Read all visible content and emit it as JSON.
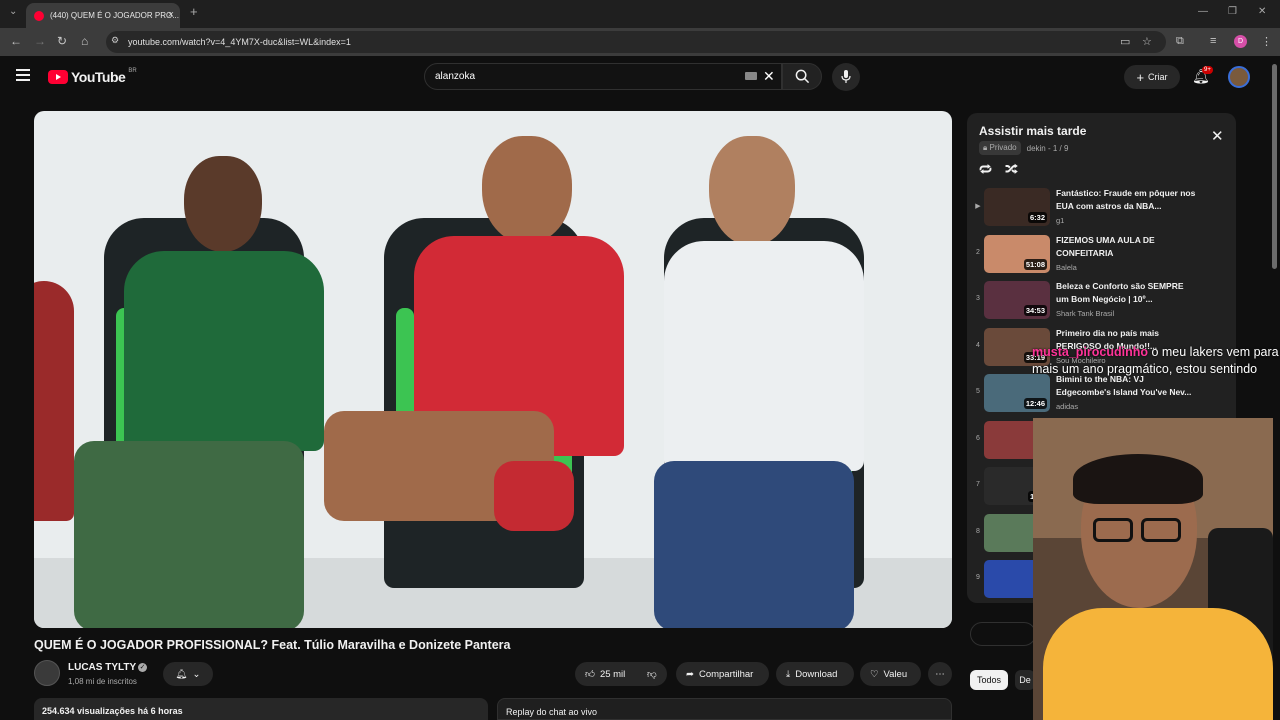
{
  "browser": {
    "tab_title": "(440) QUEM É O JOGADOR PRO...",
    "url": "youtube.com/watch?v=4_4YM7X-duc&list=WL&index=1",
    "profile_initial": "D"
  },
  "header": {
    "logo_text": "YouTube",
    "country_code": "BR",
    "search_value": "alanzoka",
    "create_label": "Criar",
    "notif_count": "9+"
  },
  "video": {
    "title": "QUEM É O JOGADOR PROFISSIONAL? Feat. Túlio Maravilha e Donizete Pantera",
    "channel_name": "LUCAS TYLTY",
    "subscribers": "1,08 mi de inscritos",
    "likes": "25 mil",
    "share_label": "Compartilhar",
    "download_label": "Download",
    "thanks_label": "Valeu",
    "views_info": "254.634 visualizações  há 6 horas",
    "chat_replay": "Replay do chat ao vivo"
  },
  "playlist": {
    "title": "Assistir mais tarde",
    "privacy": "Privado",
    "owner_progress": "dekin - 1 / 9",
    "items": [
      {
        "index": "▶",
        "title": "Fantástico: Fraude em pôquer nos EUA com astros da NBA...",
        "channel": "g1",
        "duration": "6:32",
        "thumb_color": "#3a2a24"
      },
      {
        "index": "2",
        "title": "FIZEMOS UMA AULA DE CONFEITARIA",
        "channel": "Balela",
        "duration": "51:08",
        "thumb_color": "#c98a6a"
      },
      {
        "index": "3",
        "title": "Beleza e Conforto são SEMPRE um Bom Negócio | 10º...",
        "channel": "Shark Tank Brasil",
        "duration": "34:53",
        "thumb_color": "#5a3040"
      },
      {
        "index": "4",
        "title": "Primeiro dia no país mais PERIGOSO do Mundo!!...",
        "channel": "Sou Mochileiro",
        "duration": "33:19",
        "thumb_color": "#6a4a3a"
      },
      {
        "index": "5",
        "title": "Bimini to the NBA: VJ Edgecombe's Island You've Nev...",
        "channel": "adidas",
        "duration": "12:46",
        "thumb_color": "#4a6a7a"
      },
      {
        "index": "6",
        "title": "",
        "channel": "",
        "duration": "2",
        "thumb_color": "#8a3a3a"
      },
      {
        "index": "7",
        "title": "",
        "channel": "",
        "duration": "1:00",
        "thumb_color": "#2a2a2a"
      },
      {
        "index": "8",
        "title": "",
        "channel": "",
        "duration": "36",
        "thumb_color": "#5a7a5a"
      },
      {
        "index": "9",
        "title": "",
        "channel": "",
        "duration": "",
        "thumb_color": "#2a4aaa"
      }
    ]
  },
  "chips": {
    "all": "Todos",
    "second": "De"
  },
  "overlay_chat": {
    "user": "musta_pirocudinho",
    "message": " o meu lakers vem para mais um ano pragmático, estou sentindo"
  }
}
